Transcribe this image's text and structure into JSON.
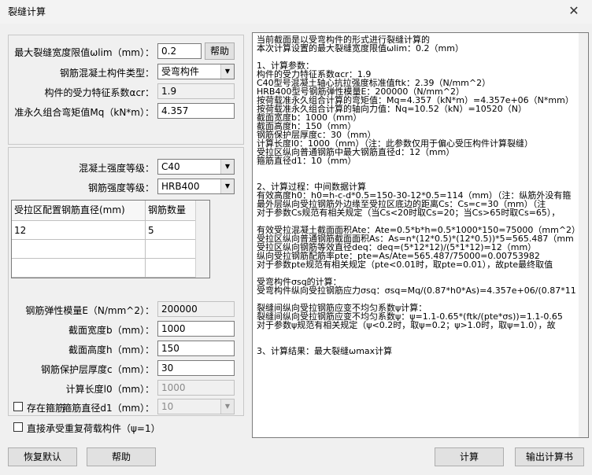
{
  "window": {
    "title": "裂缝计算",
    "close_glyph": "✕"
  },
  "top_group": {
    "wlim_label": "最大裂缝宽度限值ωlim（mm）：",
    "wlim_value": "0.2",
    "help_small_label": "帮助",
    "type_label": "钢筋混凝土构件类型：",
    "type_value": "受弯构件",
    "acr_label": "构件的受力特征系数αcr：",
    "acr_value": "1.9",
    "mq_label": "准永久组合弯矩值Mq（kN*m）：",
    "mq_value": "4.357"
  },
  "mid_group": {
    "concrete_label": "混凝土强度等级：",
    "concrete_value": "C40",
    "steel_label": "钢筋强度等级：",
    "steel_value": "HRB400",
    "grid": {
      "headers": [
        "受拉区配置钢筋直径(mm)",
        "钢筋数量"
      ],
      "rows": [
        [
          "12",
          "5"
        ],
        [
          "",
          ""
        ],
        [
          "",
          ""
        ]
      ]
    },
    "es_label": "钢筋弹性模量E（N/mm^2）：",
    "es_value": "200000",
    "b_label": "截面宽度b（mm）：",
    "b_value": "1000",
    "h_label": "截面高度h（mm）：",
    "h_value": "150",
    "c_label": "钢筋保护层厚度c（mm）：",
    "c_value": "30",
    "l0_label": "计算长度l0（mm）：",
    "l0_value": "1000",
    "stirrup_check_label": "存在箍筋",
    "stirrup_diam_label": "箍筋直径d1（mm）：",
    "stirrup_diam_value": "10",
    "repeat_load_label": "直接承受重复荷载构件（ψ=1）"
  },
  "result_text": "当前截面是以受弯构件的形式进行裂缝计算的\n本次计算设置的最大裂缝宽度限值ωlim：0.2（mm）\n\n1、计算参数：\n构件的受力特征系数αcr：1.9\nC40型号混凝土轴心抗拉强度标准值ftk：2.39（N/mm^2）\nHRB400型号钢筋弹性模量E：200000（N/mm^2）\n按荷载准永久组合计算的弯矩值：Mq=4.357（kN*m）=4.357e+06（N*mm）\n按荷载准永久组合计算的轴向力值：Nq=10.52（kN）=10520（N）\n截面宽度b：1000（mm）\n截面高度h：150（mm）\n钢筋保护层厚度c：30（mm）\n计算长度l0：1000（mm）（注：此参数仅用于偏心受压构件计算裂缝）\n受拉区纵向普通钢筋中最大钢筋直径d：12（mm）\n箍筋直径d1：10（mm）\n\n\n2、计算过程：中间数据计算\n有效高度h0：h0=h-c-d*0.5=150-30-12*0.5=114（mm）（注：纵筋外没有箍\n最外层纵向受拉钢筋外边缘至受拉区底边的距离Cs：Cs=c=30（mm）（注\n对于参数Cs规范有相关规定（当Cs<20时取Cs=20；当Cs>65时取Cs=65），\n\n有效受拉混凝土截面面积Ate：Ate=0.5*b*h=0.5*1000*150=75000（mm^2）\n受拉区纵向普通钢筋截面面积As：As=n*(12*0.5)*(12*0.5))*5=565.487（mm\n受拉区纵向钢筋等效直径deq：deq=(5*12*12)/(5*1*12)=12（mm）\n纵向受拉钢筋配筋率pte：pte=As/Ate=565.487/75000=0.00753982\n对于参数pte规范有相关规定（pte<0.01时，取pte=0.01），故pte最终取值\n\n受弯构件σsq的计算：\n受弯构件纵向受拉钢筋应力σsq：σsq=Mq/(0.87*h0*As)=4.357e+06/(0.87*11\n\n裂缝间纵向受拉钢筋应变不均匀系数ψ计算：\n裂缝间纵向受拉钢筋应变不均匀系数ψ：ψ=1.1-0.65*(ftk/(pte*σs))=1.1-0.65\n对于参数ψ规范有相关规定（ψ<0.2时，取ψ=0.2；ψ>1.0时，取ψ=1.0），故\n\n\n3、计算结果：最大裂缝ωmax计算",
  "buttons": {
    "reset": "恢复默认",
    "help": "帮助",
    "calculate": "计算",
    "export": "输出计算书"
  },
  "colors": {
    "window_bg": "#f0f0f0",
    "field_bg": "#ffffff",
    "border": "#7a7a7a"
  }
}
